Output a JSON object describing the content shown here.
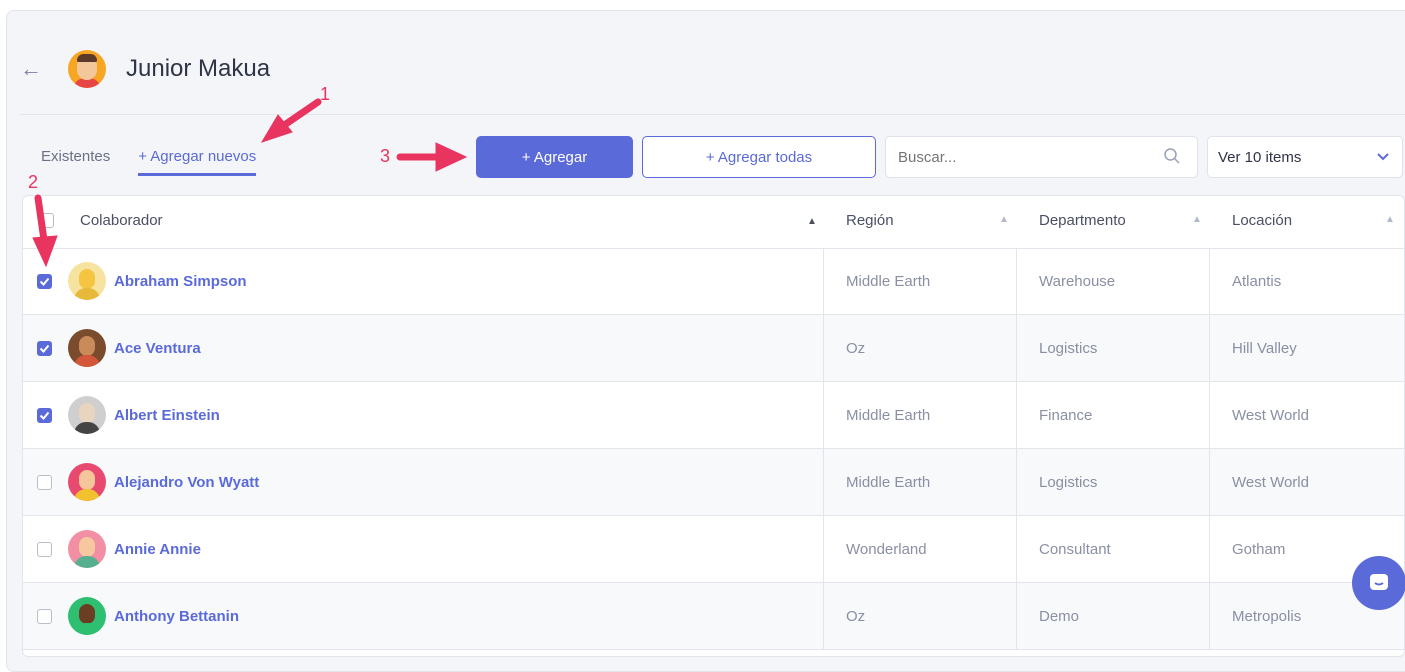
{
  "header": {
    "title": "Junior Makua"
  },
  "tabs": [
    {
      "label": "Existentes"
    },
    {
      "label": "+ Agregar nuevos"
    }
  ],
  "toolbar": {
    "add_label": "+ Agregar",
    "add_all_label": "+ Agregar todas",
    "search_placeholder": "Buscar...",
    "page_size": "Ver 10 items"
  },
  "table": {
    "columns": [
      "Colaborador",
      "Región",
      "Departmento",
      "Locación"
    ],
    "rows": [
      {
        "checked": true,
        "name": "Abraham Simpson",
        "region": "Middle Earth",
        "department": "Warehouse",
        "location": "Atlantis"
      },
      {
        "checked": true,
        "name": "Ace Ventura",
        "region": "Oz",
        "department": "Logistics",
        "location": "Hill Valley"
      },
      {
        "checked": true,
        "name": "Albert Einstein",
        "region": "Middle Earth",
        "department": "Finance",
        "location": "West World"
      },
      {
        "checked": false,
        "name": "Alejandro Von Wyatt",
        "region": "Middle Earth",
        "department": "Logistics",
        "location": "West World"
      },
      {
        "checked": false,
        "name": "Annie Annie",
        "region": "Wonderland",
        "department": "Consultant",
        "location": "Gotham"
      },
      {
        "checked": false,
        "name": "Anthony Bettanin",
        "region": "Oz",
        "department": "Demo",
        "location": "Metropolis"
      }
    ]
  },
  "annotations": [
    "1",
    "2",
    "3"
  ],
  "colors": {
    "accent": "#5b6ad9",
    "annotation": "#e8345f"
  }
}
